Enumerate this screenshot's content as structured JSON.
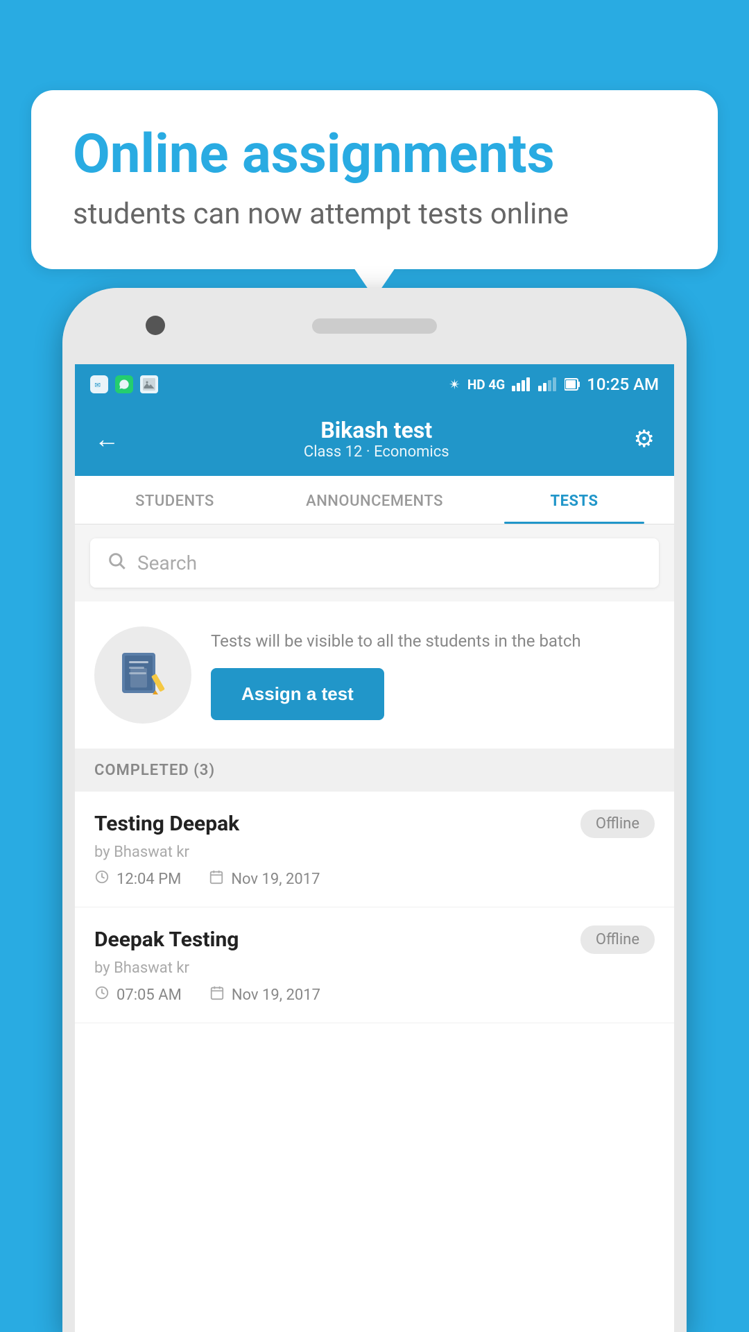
{
  "background_color": "#29abe2",
  "bubble": {
    "title": "Online assignments",
    "subtitle": "students can now attempt tests online"
  },
  "status_bar": {
    "time": "10:25 AM",
    "network": "HD 4G"
  },
  "top_bar": {
    "title": "Bikash test",
    "subtitle": "Class 12 · Economics",
    "back_label": "←",
    "settings_label": "⚙"
  },
  "tabs": [
    {
      "label": "STUDENTS",
      "active": false
    },
    {
      "label": "ANNOUNCEMENTS",
      "active": false
    },
    {
      "label": "TESTS",
      "active": true
    }
  ],
  "search": {
    "placeholder": "Search"
  },
  "assign_section": {
    "description": "Tests will be visible to all the students in the batch",
    "button_label": "Assign a test"
  },
  "completed_section": {
    "header": "COMPLETED (3)",
    "items": [
      {
        "name": "Testing Deepak",
        "by": "by Bhaswat kr",
        "time": "12:04 PM",
        "date": "Nov 19, 2017",
        "status": "Offline"
      },
      {
        "name": "Deepak Testing",
        "by": "by Bhaswat kr",
        "time": "07:05 AM",
        "date": "Nov 19, 2017",
        "status": "Offline"
      }
    ]
  }
}
